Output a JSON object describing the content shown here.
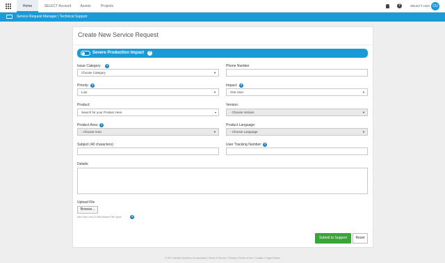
{
  "nav": {
    "tabs": [
      {
        "label": "Home"
      },
      {
        "label": "SELECT Account"
      },
      {
        "label": "Assets"
      },
      {
        "label": "Projects"
      }
    ],
    "user_name": "SELECT User",
    "avatar_initials": "CU"
  },
  "bar": {
    "title": "Service Request Manager | Technical Support"
  },
  "form": {
    "title": "Create New Service Request",
    "severe_label": "Severe Production Impact",
    "issue_category": {
      "label": "Issue Category",
      "value": "Choose Category"
    },
    "phone": {
      "label": "Phone Number",
      "value": ""
    },
    "priority": {
      "label": "Priority:",
      "value": "Low"
    },
    "impact": {
      "label": "Impact:",
      "value": "One User"
    },
    "product": {
      "label": "Product:",
      "placeholder": "Search for your Product Here"
    },
    "version": {
      "label": "Version:",
      "value": "- Choose Version"
    },
    "product_area": {
      "label": "Product Area:",
      "value": "- Choose Area"
    },
    "product_language": {
      "label": "Product Language:",
      "value": "- Choose Language"
    },
    "subject": {
      "label": "Subject (40 characters):",
      "value": ""
    },
    "user_tracking": {
      "label": "User Tracking Number:",
      "value": ""
    },
    "details": {
      "label": "Details:"
    },
    "upload": {
      "label": "Upload File",
      "browse_label": "Browse...",
      "hint": "Max Size Limit 20 MB Allowed File Types"
    },
    "submit_label": "Submit to Support",
    "reset_label": "Reset"
  },
  "footer": {
    "text": "© 2017 Bentley Systems, Incorporated | Terms of Service | Privacy | Terms of Use | Cookies | Legal Notices"
  },
  "colors": {
    "accent": "#1a9ad6",
    "submit": "#3aa33a"
  }
}
